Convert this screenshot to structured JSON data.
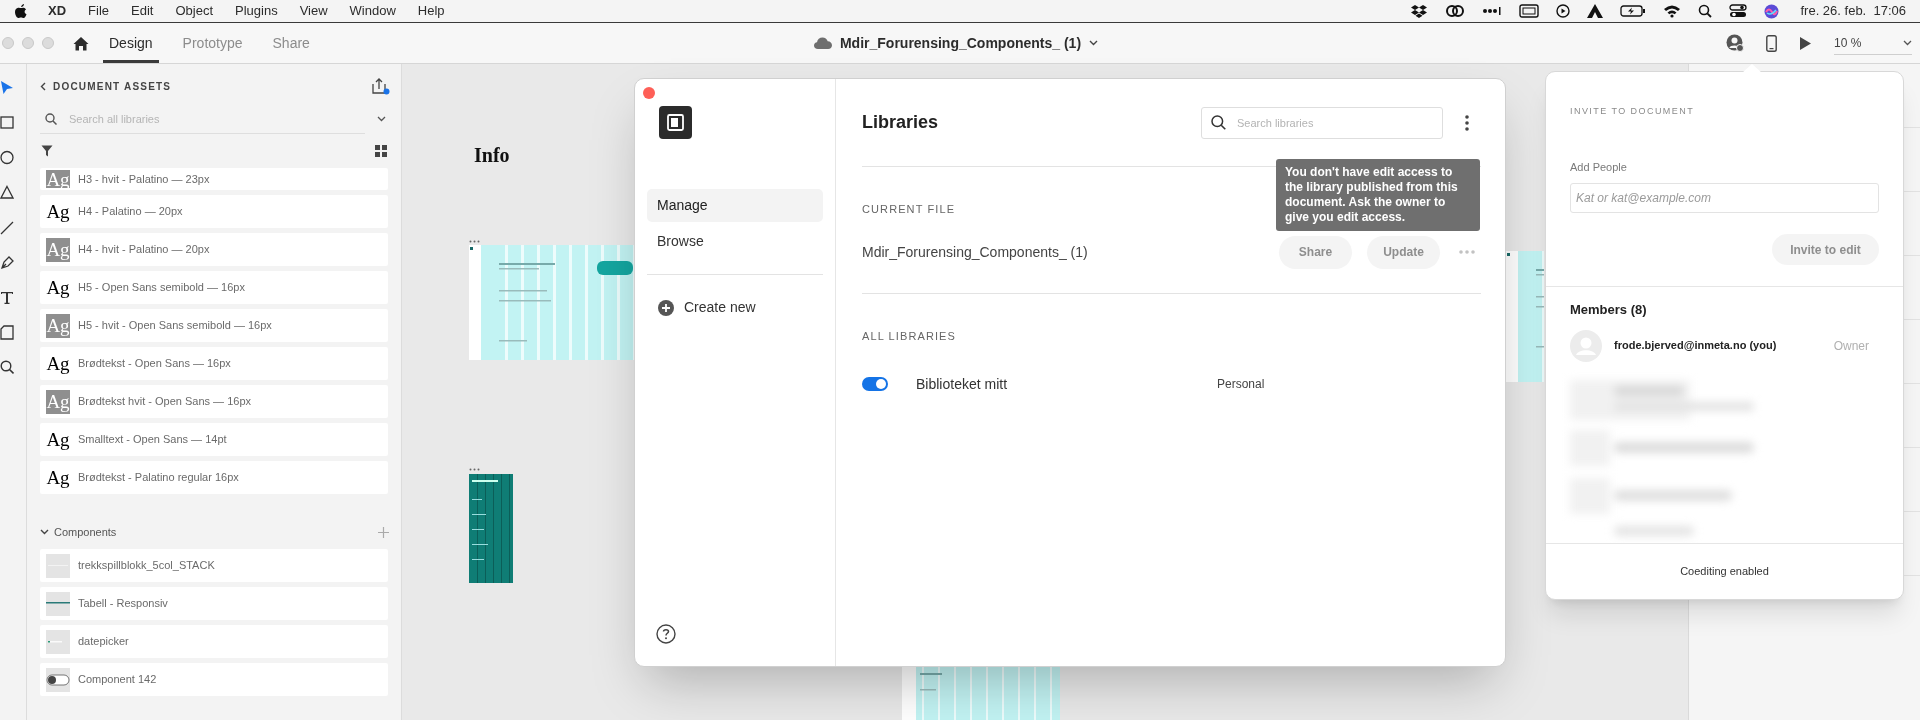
{
  "menu_bar": {
    "app": "XD",
    "items": [
      "File",
      "Edit",
      "Object",
      "Plugins",
      "View",
      "Window",
      "Help"
    ],
    "clock": "fre. 26. feb.  17:06"
  },
  "toolbar": {
    "tabs": [
      {
        "label": "Design",
        "selected": true
      },
      {
        "label": "Prototype",
        "selected": false
      },
      {
        "label": "Share",
        "selected": false
      }
    ],
    "document_title": "Mdir_Forurensing_Components_ (1)",
    "zoom": "10 %"
  },
  "assets_panel": {
    "title": "DOCUMENT ASSETS",
    "search": {
      "placeholder": "Search all libraries"
    },
    "text_styles": [
      {
        "sample": "Ag",
        "label": "H3 - hvit - Palatino — 23px",
        "light": true
      },
      {
        "sample": "Ag",
        "label": "H4 - Palatino — 20px",
        "light": false
      },
      {
        "sample": "Ag",
        "label": "H4 - hvit - Palatino — 20px",
        "light": true
      },
      {
        "sample": "Ag",
        "label": "H5 - Open Sans semibold — 16px",
        "light": false
      },
      {
        "sample": "Ag",
        "label": "H5 - hvit - Open Sans semibold — 16px",
        "light": true
      },
      {
        "sample": "Ag",
        "label": "Brødtekst - Open Sans — 16px",
        "light": false
      },
      {
        "sample": "Ag",
        "label": "Brødtekst hvit - Open Sans — 16px",
        "light": true
      },
      {
        "sample": "Ag",
        "label": "Smalltext - Open Sans — 14pt",
        "light": false
      },
      {
        "sample": "Ag",
        "label": "Brødtekst - Palatino regular 16px",
        "light": false
      }
    ],
    "components_heading": "Components",
    "components": [
      {
        "label": "trekkspillblokk_5col_STACK",
        "kind": "blank"
      },
      {
        "label": "Tabell - Responsiv",
        "kind": "line"
      },
      {
        "label": "datepicker",
        "kind": "datepicker"
      },
      {
        "label": "Component 142",
        "kind": "toggle"
      }
    ]
  },
  "canvas": {
    "heading": "Info"
  },
  "libraries_dialog": {
    "nav": [
      {
        "label": "Manage",
        "selected": true
      },
      {
        "label": "Browse",
        "selected": false
      }
    ],
    "create_new": "Create new",
    "title": "Libraries",
    "search": {
      "placeholder": "Search libraries"
    },
    "current_file_heading": "CURRENT FILE",
    "current_file": "Mdir_Forurensing_Components_ (1)",
    "buttons": [
      {
        "label": "Share",
        "disabled": true
      },
      {
        "label": "Update",
        "disabled": true
      }
    ],
    "tooltip": "You don't have edit access to the library published from this document. Ask the owner to give you edit access.",
    "all_libraries_heading": "ALL LIBRARIES",
    "libraries": [
      {
        "name": "Biblioteket mitt",
        "type": "Personal",
        "on": true
      }
    ]
  },
  "invite_panel": {
    "title": "INVITE TO DOCUMENT",
    "add_people_label": "Add People",
    "input": {
      "placeholder": "Kat or kat@example.com"
    },
    "invite_button": {
      "label": "Invite to edit",
      "disabled": true
    },
    "members_heading": "Members (8)",
    "members": [
      {
        "email": "frode.bjerved@inmeta.no (you)",
        "role": "Owner"
      }
    ],
    "footer": "Coediting enabled"
  }
}
